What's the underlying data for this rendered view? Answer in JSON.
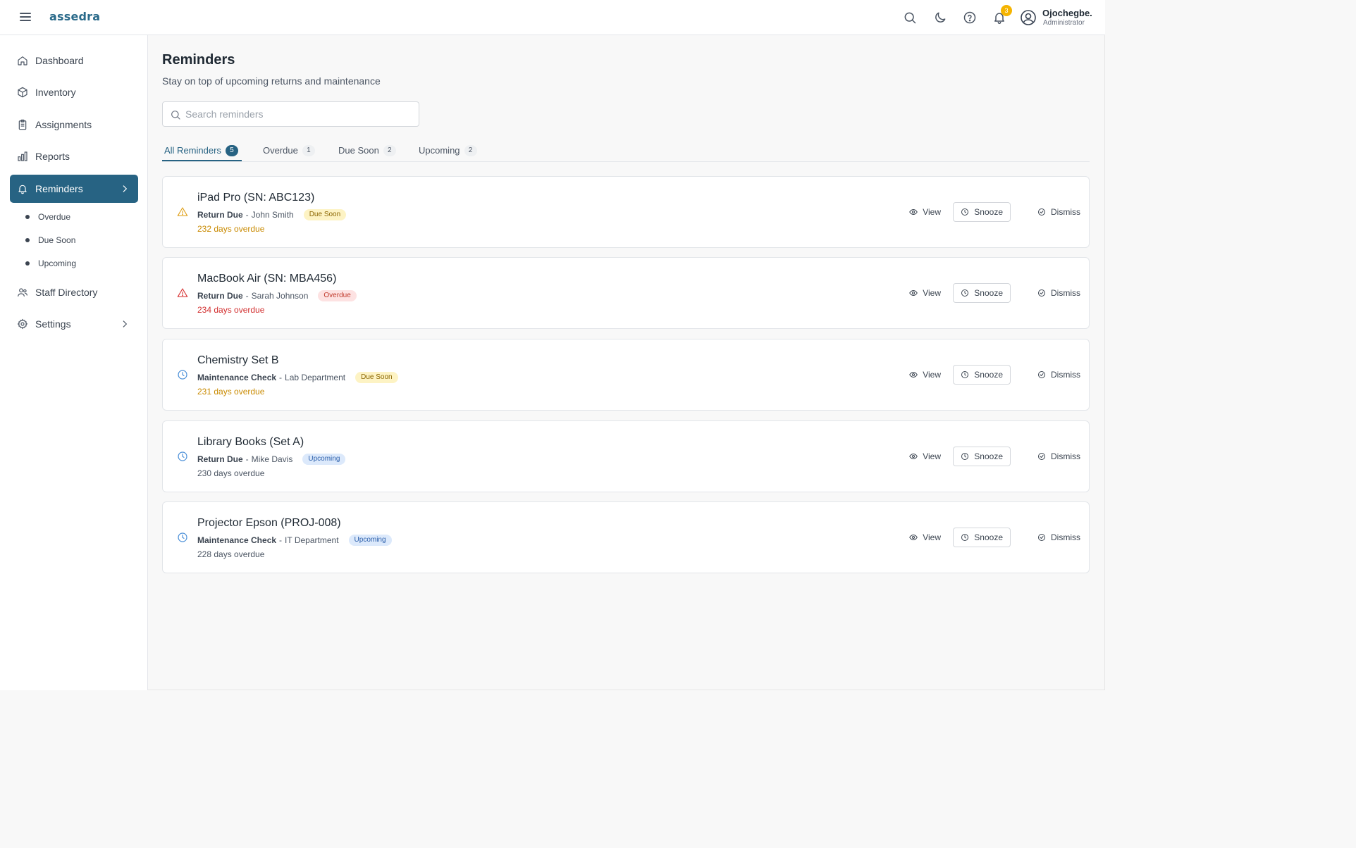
{
  "app": {
    "logo": "assedra"
  },
  "header": {
    "notification_count": "3",
    "user": {
      "name": "Ojochegbe.",
      "role": "Administrator"
    }
  },
  "sidebar": {
    "items": [
      {
        "label": "Dashboard",
        "icon": "home-icon"
      },
      {
        "label": "Inventory",
        "icon": "box-icon"
      },
      {
        "label": "Assignments",
        "icon": "clipboard-icon"
      },
      {
        "label": "Reports",
        "icon": "bar-chart-icon"
      },
      {
        "label": "Reminders",
        "icon": "bell-icon",
        "active": true
      },
      {
        "label": "Staff Directory",
        "icon": "users-icon"
      },
      {
        "label": "Settings",
        "icon": "gear-icon"
      }
    ],
    "sub_items": [
      "Overdue",
      "Due Soon",
      "Upcoming"
    ]
  },
  "page": {
    "title": "Reminders",
    "subtitle": "Stay on top of upcoming returns and maintenance"
  },
  "search": {
    "placeholder": "Search reminders",
    "value": ""
  },
  "tabs": [
    {
      "label": "All Reminders",
      "count": "5",
      "active": true
    },
    {
      "label": "Overdue",
      "count": "1"
    },
    {
      "label": "Due Soon",
      "count": "2"
    },
    {
      "label": "Upcoming",
      "count": "2"
    }
  ],
  "actions": {
    "view": "View",
    "snooze": "Snooze",
    "dismiss": "Dismiss"
  },
  "reminders": [
    {
      "title": "iPad Pro (SN: ABC123)",
      "type": "Return Due",
      "separator": "-",
      "assignee": "John Smith",
      "status": "Due Soon",
      "days": "232 days overdue",
      "icon": "warning-triangle-icon"
    },
    {
      "title": "MacBook Air (SN: MBA456)",
      "type": "Return Due",
      "separator": "-",
      "assignee": "Sarah Johnson",
      "status": "Overdue",
      "days": "234 days overdue",
      "icon": "warning-triangle-icon"
    },
    {
      "title": "Chemistry Set B",
      "type": "Maintenance Check",
      "separator": "-",
      "assignee": "Lab Department",
      "status": "Due Soon",
      "days": "231 days overdue",
      "icon": "clock-icon"
    },
    {
      "title": "Library Books (Set A)",
      "type": "Return Due",
      "separator": "-",
      "assignee": "Mike Davis",
      "status": "Upcoming",
      "days": "230 days overdue",
      "icon": "clock-icon"
    },
    {
      "title": "Projector Epson (PROJ-008)",
      "type": "Maintenance Check",
      "separator": "-",
      "assignee": "IT Department",
      "status": "Upcoming",
      "days": "228 days overdue",
      "icon": "clock-icon"
    }
  ],
  "colors": {
    "primary": "#276383",
    "due_soon": "#c98a00",
    "overdue": "#d22f2f",
    "upcoming": "#2b5fab",
    "notification": "#f5b400"
  }
}
